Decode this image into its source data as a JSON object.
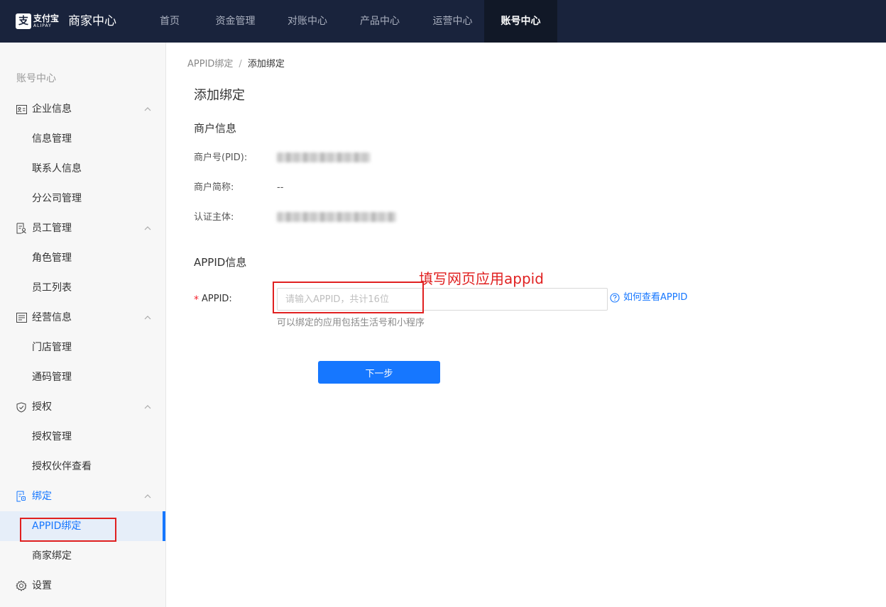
{
  "header": {
    "logo": {
      "icon": "alipay-logo-icon",
      "mark": "支",
      "cn": "支付宝",
      "en": "ALIPAY"
    },
    "app_title": "商家中心",
    "nav": [
      {
        "label": "首页",
        "active": false
      },
      {
        "label": "资金管理",
        "active": false
      },
      {
        "label": "对账中心",
        "active": false
      },
      {
        "label": "产品中心",
        "active": false
      },
      {
        "label": "运营中心",
        "active": false
      },
      {
        "label": "账号中心",
        "active": true
      }
    ]
  },
  "sidebar": {
    "heading": "账号中心",
    "groups": [
      {
        "label": "企业信息",
        "icon": "id-card-icon",
        "items": [
          "信息管理",
          "联系人信息",
          "分公司管理"
        ]
      },
      {
        "label": "员工管理",
        "icon": "staff-document-icon",
        "items": [
          "角色管理",
          "员工列表"
        ]
      },
      {
        "label": "经营信息",
        "icon": "business-list-icon",
        "items": [
          "门店管理",
          "通码管理"
        ]
      },
      {
        "label": "授权",
        "icon": "shield-check-icon",
        "items": [
          "授权管理",
          "授权伙伴查看"
        ]
      },
      {
        "label": "绑定",
        "icon": "bind-document-icon",
        "active": true,
        "items": [
          "APPID绑定",
          "商家绑定"
        ],
        "selected_item": "APPID绑定"
      },
      {
        "label": "设置",
        "icon": "gear-icon",
        "items": []
      }
    ]
  },
  "breadcrumb": {
    "parent": "APPID绑定",
    "separator": "/",
    "current": "添加绑定"
  },
  "page_title": "添加绑定",
  "merchant_section": {
    "title": "商户信息",
    "fields": [
      {
        "label": "商户号(PID):",
        "value": ""
      },
      {
        "label": "商户简称:",
        "value": "--"
      },
      {
        "label": "认证主体:",
        "value": ""
      }
    ]
  },
  "appid_section": {
    "title": "APPID信息",
    "required_mark": "*",
    "label": "APPID:",
    "placeholder": "请输入APPID，共计16位",
    "value": "",
    "help_link": "如何查看APPID",
    "hint": "可以绑定的应用包括生活号和小程序"
  },
  "next_button": "下一步",
  "annotation": {
    "text": "填写网页应用appid",
    "color": "#e02020"
  },
  "colors": {
    "topbar": "#19233c",
    "primary": "#1677ff",
    "annotation": "#e02020"
  }
}
